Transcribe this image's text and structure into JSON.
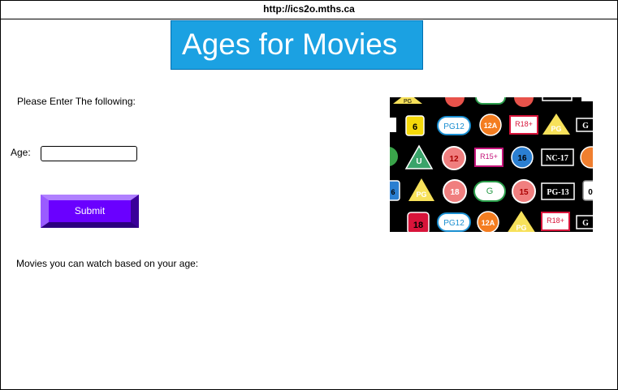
{
  "browser": {
    "url": "http://ics2o.mths.ca"
  },
  "header": {
    "title": "Ages for Movies"
  },
  "form": {
    "prompt": "Please Enter The following:",
    "age_label": "Age:",
    "age_value": "",
    "submit_label": "Submit"
  },
  "output": {
    "label": "Movies you can watch based on your age:"
  },
  "ratings_image": {
    "badges": [
      "PG",
      "6",
      "PG12",
      "12A",
      "R18+",
      "PG",
      "G",
      "U",
      "12",
      "R15+",
      "16",
      "NC-17",
      "6",
      "PG",
      "18",
      "G",
      "15",
      "PG-13",
      "0",
      "18",
      "PG12",
      "12A",
      "PG",
      "R18+",
      "G"
    ]
  },
  "colors": {
    "title_bg": "#1ba1e2",
    "button": "#6a00ff"
  }
}
